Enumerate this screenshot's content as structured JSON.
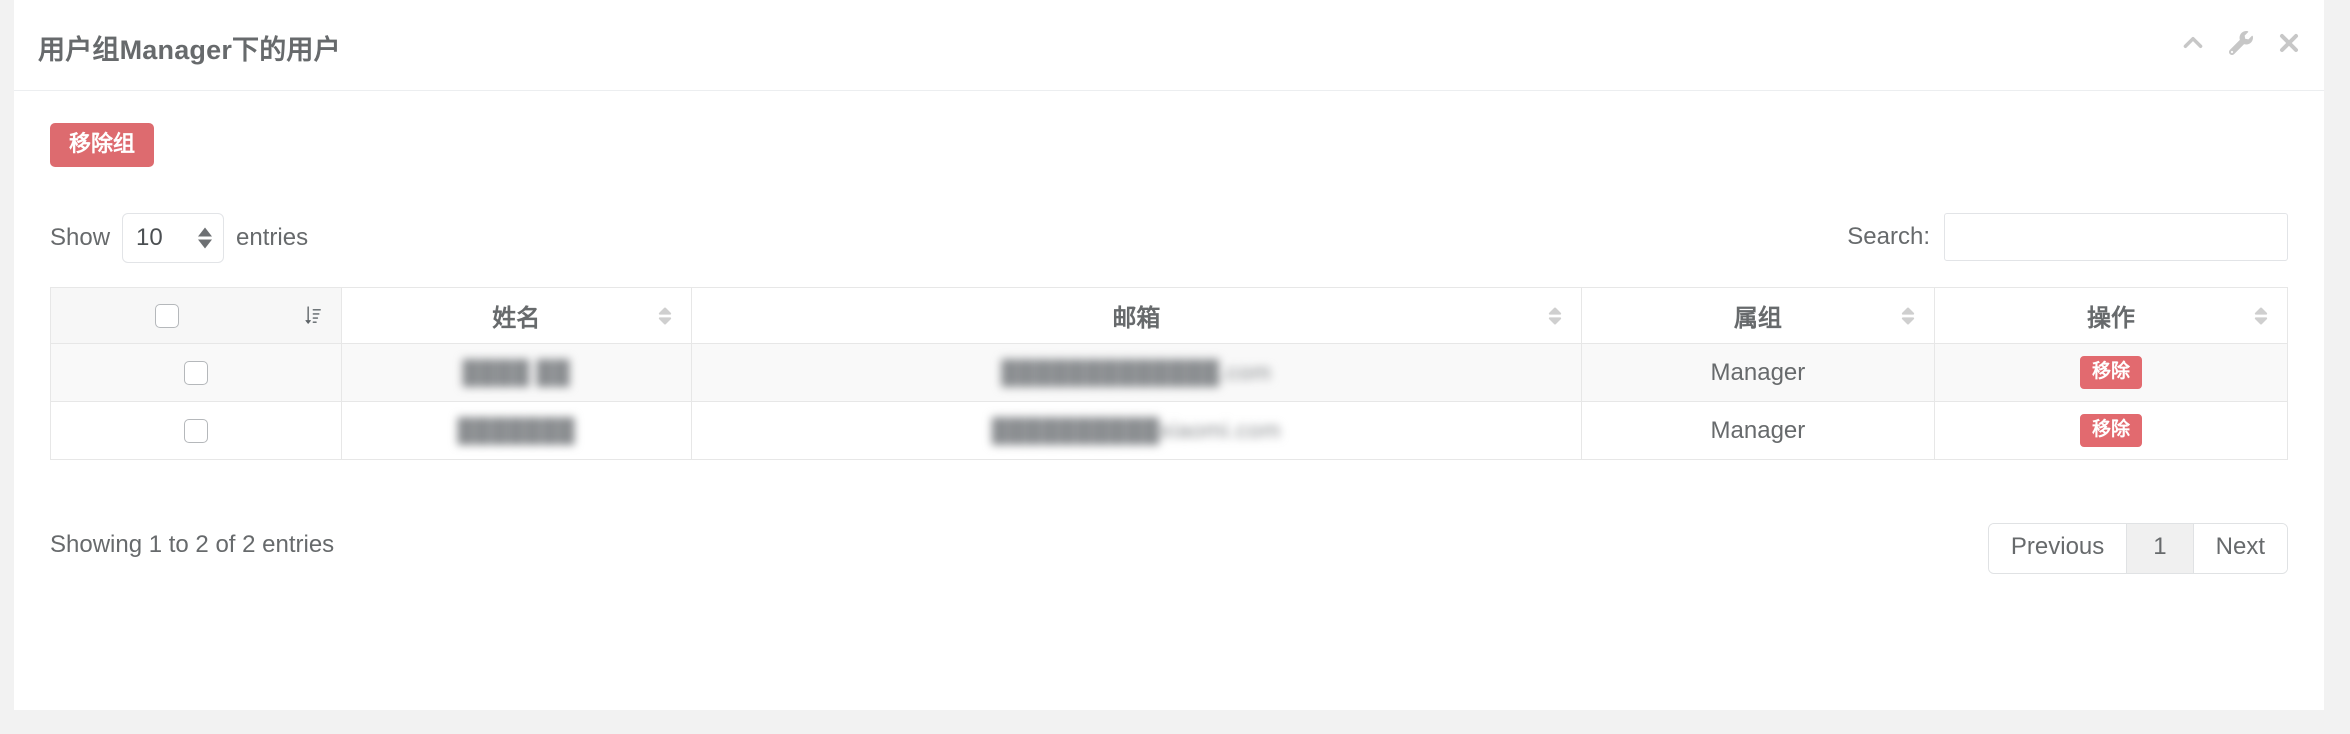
{
  "panel": {
    "title": "用户组Manager下的用户",
    "tools": [
      {
        "name": "collapse-icon",
        "icon": "chevron-up"
      },
      {
        "name": "settings-icon",
        "icon": "wrench"
      },
      {
        "name": "close-icon",
        "icon": "times"
      }
    ]
  },
  "toolbar": {
    "remove_group_label": "移除组"
  },
  "controls": {
    "length_prefix": "Show",
    "length_value": "10",
    "length_suffix": "entries",
    "search_label": "Search:",
    "search_value": "",
    "search_placeholder": ""
  },
  "table": {
    "columns": [
      {
        "key": "check",
        "label": "",
        "sort": "desc",
        "sort_icon": "sort-amount-desc"
      },
      {
        "key": "name",
        "label": "姓名",
        "sort": "none",
        "sort_icon": "sort"
      },
      {
        "key": "email",
        "label": "邮箱",
        "sort": "none",
        "sort_icon": "sort"
      },
      {
        "key": "group",
        "label": "属组",
        "sort": "none",
        "sort_icon": "sort"
      },
      {
        "key": "ops",
        "label": "操作",
        "sort": "none",
        "sort_icon": "sort"
      }
    ],
    "rows": [
      {
        "selected": false,
        "name": "████ ██",
        "email": "█████████████.com",
        "group": "Manager",
        "action_label": "移除"
      },
      {
        "selected": false,
        "name": "███████",
        "email": "██████████xiaomi.com",
        "group": "Manager",
        "action_label": "移除"
      }
    ]
  },
  "footer": {
    "info": "Showing 1 to 2 of 2 entries",
    "pagination": {
      "previous": "Previous",
      "pages": [
        "1"
      ],
      "next": "Next"
    }
  },
  "colors": {
    "danger": "#dd6b6f",
    "danger_row": "#e26a6f",
    "text": "#676a6c",
    "panel_bg": "#ffffff",
    "page_bg": "#f2f2f2",
    "border": "#e7e7e7",
    "stripe": "#f9f9f9"
  }
}
